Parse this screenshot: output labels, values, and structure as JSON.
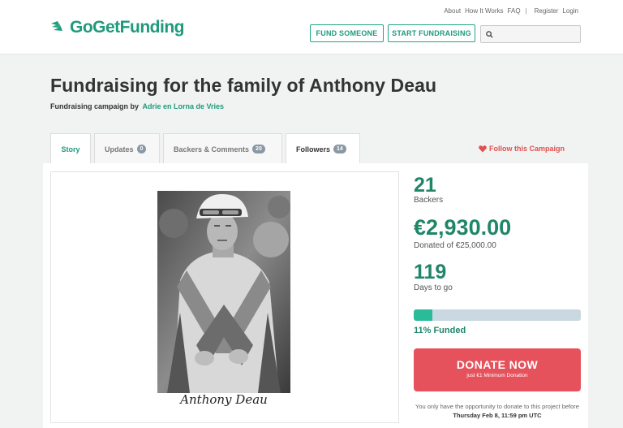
{
  "brand": {
    "name": "GoGetFunding",
    "color": "#1f9a7c",
    "logo_icon": "wing-logo-icon"
  },
  "top_links": [
    "About",
    "How It Works",
    "FAQ",
    "Register",
    "Login"
  ],
  "nav": {
    "fund_someone": "FUND SOMEONE",
    "start_fundraising": "START FUNDRAISING",
    "search_placeholder": ""
  },
  "campaign": {
    "title": "Fundraising for the family of Anthony Deau",
    "byline_prefix": "Fundraising campaign by",
    "author": "Adrie en Lorna de Vries"
  },
  "tabs": [
    {
      "label": "Story"
    },
    {
      "label": "Updates",
      "count": "0"
    },
    {
      "label": "Backers & Comments",
      "count": "20"
    },
    {
      "label": "Followers",
      "count": "14"
    }
  ],
  "follow_label": "Follow this Campaign",
  "media": {
    "caption": "Anthony Deau"
  },
  "stats": {
    "backers": "21",
    "backers_label": "Backers",
    "raised": "€2,930.00",
    "raised_label": "Donated of €25,000.00",
    "days": "119",
    "days_label": "Days to go",
    "funded_pct": 0.11,
    "funded_label": "11% Funded"
  },
  "donate": {
    "label": "DONATE NOW",
    "sublabel": "just €1 Minimum Donation"
  },
  "notice": {
    "text": "You only have the opportunity to donate to this project before",
    "deadline": "Thursday Feb 8, 11:59 pm UTC"
  },
  "colors": {
    "accent": "#1f9a7c",
    "donate": "#e5525c",
    "progress": "#2cbb98",
    "follow": "#e2514f"
  }
}
